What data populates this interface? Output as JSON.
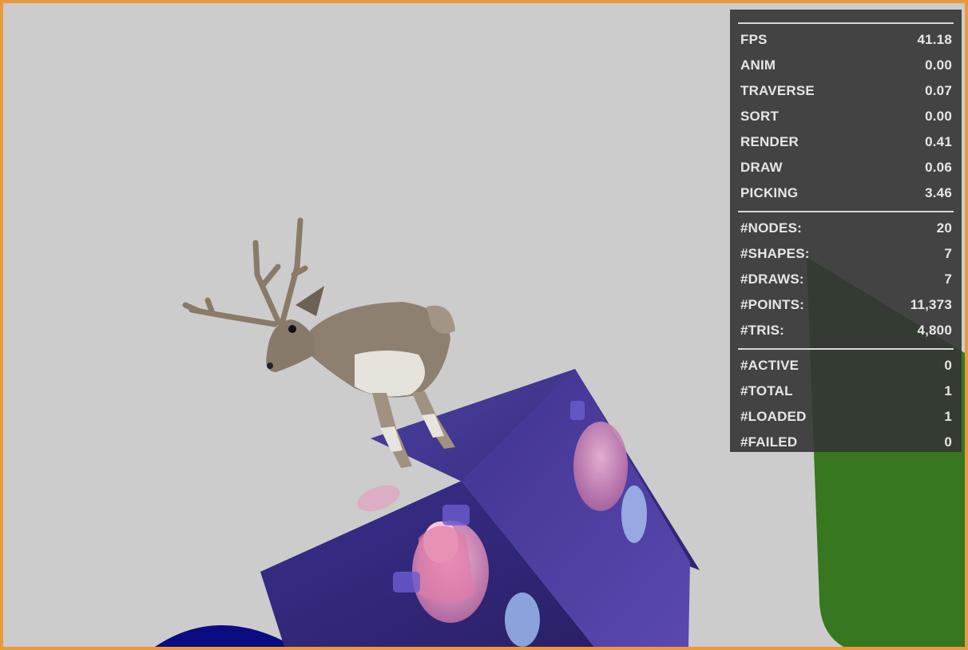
{
  "scene": {
    "objects": [
      "deer-model",
      "textured-cube",
      "blue-sphere",
      "green-cylinder"
    ],
    "background_color": "#cccccc",
    "border_color": "#e89a3c"
  },
  "stats": {
    "timing": [
      {
        "label": "FPS",
        "value": "41.18"
      },
      {
        "label": "ANIM",
        "value": "0.00"
      },
      {
        "label": "TRAVERSE",
        "value": "0.07"
      },
      {
        "label": "SORT",
        "value": "0.00"
      },
      {
        "label": "RENDER",
        "value": "0.41"
      },
      {
        "label": "DRAW",
        "value": "0.06"
      },
      {
        "label": "PICKING",
        "value": "3.46"
      }
    ],
    "geometry": [
      {
        "label": "#NODES:",
        "value": "20"
      },
      {
        "label": "#SHAPES:",
        "value": "7"
      },
      {
        "label": "#DRAWS:",
        "value": "7"
      },
      {
        "label": "#POINTS:",
        "value": "11,373"
      },
      {
        "label": "#TRIS:",
        "value": "4,800"
      }
    ],
    "loading": [
      {
        "label": "#ACTIVE",
        "value": "0"
      },
      {
        "label": "#TOTAL",
        "value": "1"
      },
      {
        "label": "#LOADED",
        "value": "1"
      },
      {
        "label": "#FAILED",
        "value": "0"
      }
    ]
  }
}
